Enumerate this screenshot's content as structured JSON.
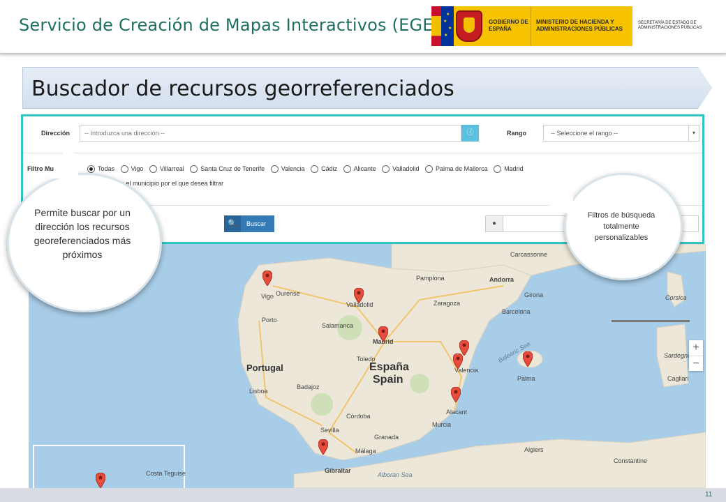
{
  "header": {
    "title": "Servicio de Creación de Mapas Interactivos (EGEO)",
    "gov_logo_text": "GOBIERNO DE ESPAÑA",
    "ministry_text": "MINISTERIO DE HACIENDA Y ADMINISTRACIONES PÚBLICAS",
    "secretaria_text": "SECRETARÍA DE ESTADO DE ADMINISTRACIONES PÚBLICAS"
  },
  "section": {
    "title": "Buscador de recursos georreferenciados"
  },
  "form": {
    "direccion_label": "Dirección",
    "direccion_placeholder": "-- Introduzca una dirección --",
    "rango_label": "Rango",
    "rango_value": "-- Seleccione el rango --",
    "filtro_label": "Filtro Mu",
    "municipios": [
      "Todas",
      "Vigo",
      "Villarreal",
      "Santa Cruz de Tenerife",
      "Valencia",
      "Cádiz",
      "Alicante",
      "Valladolid",
      "Palma de Mallorca",
      "Madrid"
    ],
    "selected_index": 0,
    "hint": "e el municipio por el que desea filtrar",
    "buscar_label": "Buscar"
  },
  "callouts": {
    "left": "Permite buscar por un dirección los recursos georeferenciados más próximos",
    "right": "Filtros de búsqueda totalmente personalizables"
  },
  "map": {
    "labels": {
      "portugal": "Portugal",
      "espana": "España",
      "spain": "Spain",
      "madrid": "Madrid",
      "valladolid": "Valladolid",
      "salamanca": "Salamanca",
      "zaragoza": "Zaragoza",
      "barcelona": "Barcelona",
      "valencia": "Valencia",
      "murcia": "Murcia",
      "alacant": "Alacant",
      "sevilla": "Sevilla",
      "cordoba": "Córdoba",
      "granada": "Granada",
      "malaga": "Málaga",
      "gibraltar": "Gibraltar",
      "palma": "Palma",
      "lisboa": "Lisboa",
      "porto": "Porto",
      "vigo": "Vigo",
      "andorra": "Andorra",
      "pamplona": "Pamplona",
      "corsica": "Corsica",
      "sardegna": "Sardegna",
      "algiers": "Algiers",
      "alboran": "Alboran Sea",
      "balearic": "Balearic Sea",
      "costa_teguise": "Costa Teguise",
      "carcassonne": "Carcassonne",
      "girona": "Girona",
      "badajoz": "Badajoz",
      "ourense": "Ourense",
      "toledo": "Toledo",
      "cagliari": "Cagliari",
      "constantine": "Constantine"
    },
    "zoom_in": "+",
    "zoom_out": "−"
  },
  "footer": {
    "page_number": "11"
  }
}
